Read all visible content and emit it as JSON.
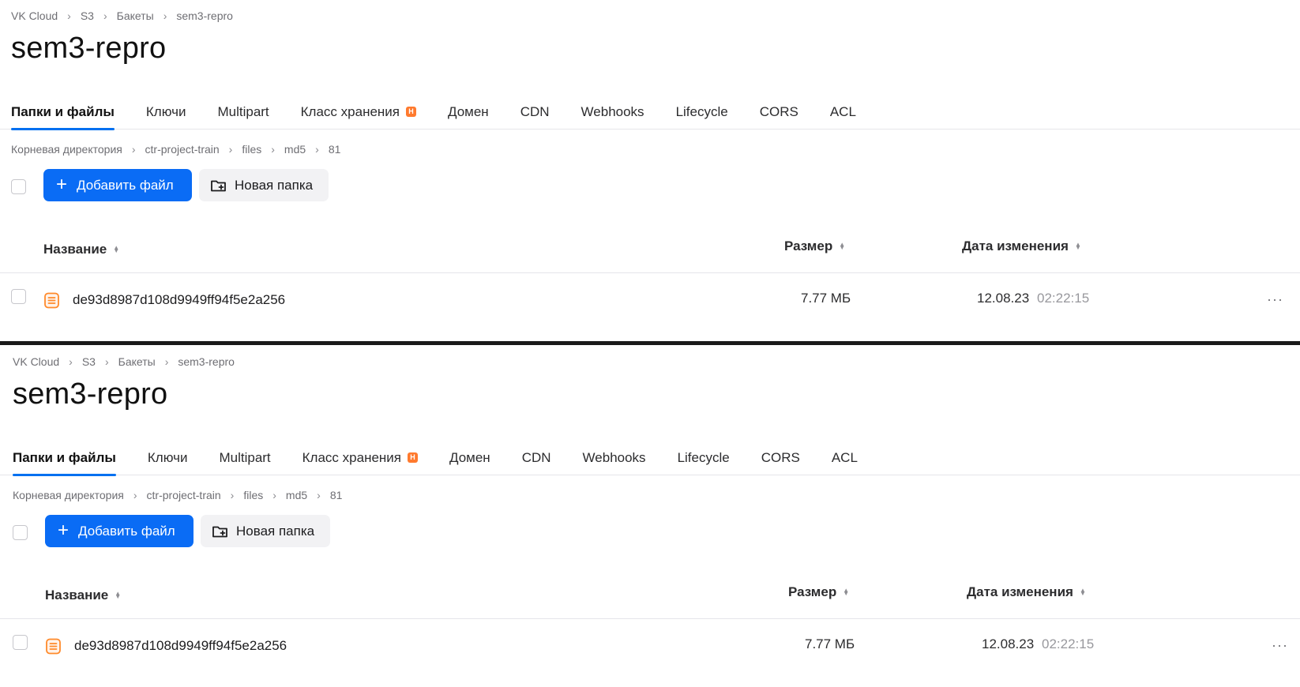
{
  "breadcrumbs": [
    "VK Cloud",
    "S3",
    "Бакеты",
    "sem3-repro"
  ],
  "page_title": "sem3-repro",
  "tabs": [
    {
      "label": "Папки и файлы",
      "active": true
    },
    {
      "label": "Ключи"
    },
    {
      "label": "Multipart"
    },
    {
      "label": "Класс хранения",
      "badge": "H"
    },
    {
      "label": "Домен"
    },
    {
      "label": "CDN"
    },
    {
      "label": "Webhooks"
    },
    {
      "label": "Lifecycle"
    },
    {
      "label": "CORS"
    },
    {
      "label": "ACL"
    }
  ],
  "path": [
    "Корневая директория",
    "ctr-project-train",
    "files",
    "md5",
    "81"
  ],
  "toolbar": {
    "add_file_label": "Добавить файл",
    "new_folder_label": "Новая папка"
  },
  "table": {
    "columns": {
      "name": "Название",
      "size": "Размер",
      "date": "Дата изменения"
    },
    "rows": [
      {
        "name": "de93d8987d108d9949ff94f5e2a256",
        "size": "7.77 МБ",
        "date": "12.08.23",
        "time": "02:22:15"
      }
    ]
  },
  "colors": {
    "accent": "#0a6cf5",
    "badge": "#ff7a2e",
    "file_icon": "#ff8a2b"
  }
}
